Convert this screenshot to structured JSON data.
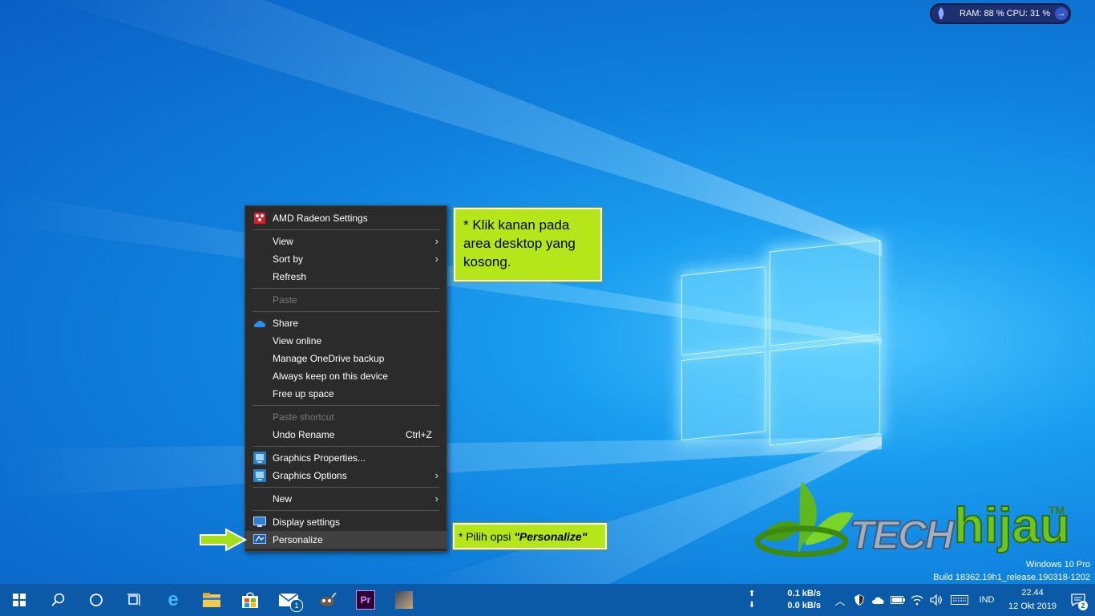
{
  "widget": {
    "text": "RAM: 88 %  CPU: 31 %"
  },
  "menu": {
    "items": [
      {
        "label": "AMD Radeon Settings",
        "icon": "amd-radeon-icon"
      },
      {
        "sep": true
      },
      {
        "label": "View",
        "submenu": true
      },
      {
        "label": "Sort by",
        "submenu": true
      },
      {
        "label": "Refresh"
      },
      {
        "sep": true
      },
      {
        "label": "Paste",
        "disabled": true
      },
      {
        "sep": true
      },
      {
        "label": "Share",
        "icon": "onedrive-cloud-icon"
      },
      {
        "label": "View online"
      },
      {
        "label": "Manage OneDrive backup"
      },
      {
        "label": "Always keep on this device"
      },
      {
        "label": "Free up space"
      },
      {
        "sep": true
      },
      {
        "label": "Paste shortcut",
        "disabled": true
      },
      {
        "label": "Undo Rename",
        "accel": "Ctrl+Z"
      },
      {
        "sep": true
      },
      {
        "label": "Graphics Properties...",
        "icon": "intel-graphics-icon"
      },
      {
        "label": "Graphics Options",
        "icon": "intel-graphics-icon",
        "submenu": true
      },
      {
        "sep": true
      },
      {
        "label": "New",
        "submenu": true
      },
      {
        "sep": true
      },
      {
        "label": "Display settings",
        "icon": "display-icon"
      },
      {
        "label": "Personalize",
        "icon": "personalize-icon",
        "highlighted": true
      }
    ]
  },
  "callouts": {
    "top": "* Klik kanan pada area desktop yang kosong.",
    "bottom_prefix": "* Pilih opsi ",
    "bottom_emph": "\"Personalize\""
  },
  "brand": {
    "tech": "TECH",
    "hijau": "hijau",
    "tm": "TM"
  },
  "watermark": {
    "line1": "Windows 10 Pro",
    "line2": "Build 18362.19h1_release.190318-1202"
  },
  "taskbar": {
    "apps": [
      "start-icon",
      "search-icon",
      "cortana-icon",
      "task-view-icon",
      "edge-icon",
      "file-explorer-icon",
      "store-icon",
      "mail-icon",
      "gimp-icon",
      "premiere-icon",
      "app-icon"
    ],
    "mail_badge": "1",
    "net_up": "0.1 kB/s",
    "net_down": "0.0 kB/s",
    "lang": "IND",
    "time": "22.44",
    "date": "12 Okt 2019",
    "notif_count": "2",
    "colors": {
      "taskbar": "#0a5aa8",
      "callout": "#b4e619"
    }
  }
}
